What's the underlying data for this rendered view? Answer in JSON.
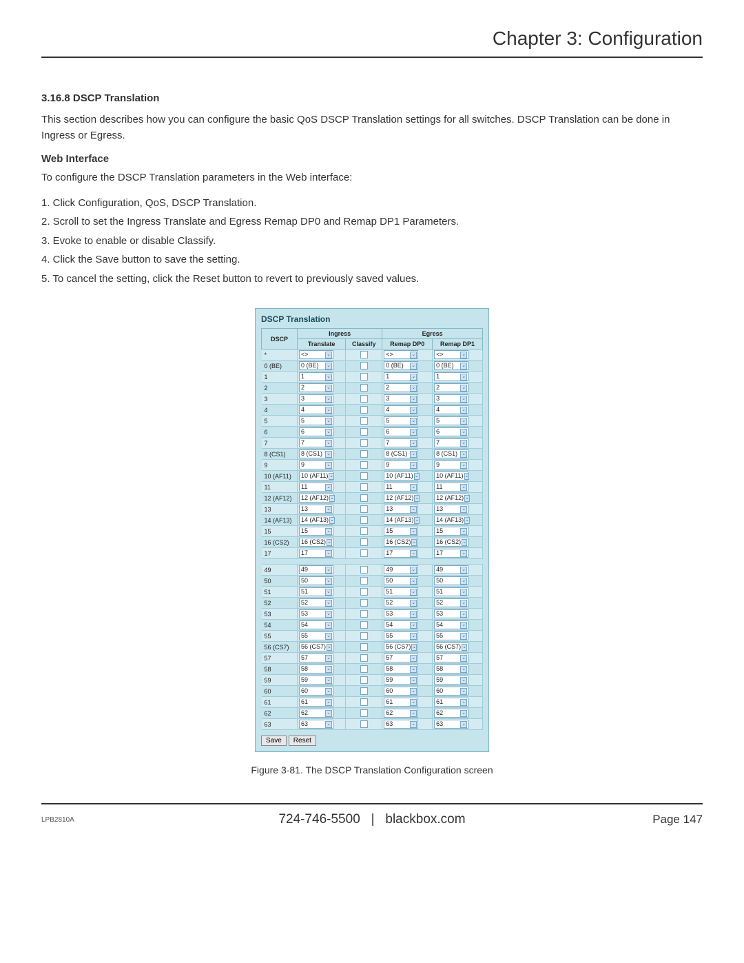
{
  "chapter": "Chapter 3: Configuration",
  "section": {
    "heading": "3.16.8 DSCP Translation",
    "intro": "This section describes how you can configure the basic QoS DSCP Translation settings for all switches. DSCP Translation can be done in Ingress or Egress.",
    "sub": "Web Interface",
    "lead": "To configure the DSCP Translation parameters in the Web interface:",
    "steps": [
      "1. Click Configuration, QoS, DSCP Translation.",
      "2. Scroll to set the Ingress Translate and Egress Remap DP0 and Remap DP1 Parameters.",
      "3. Evoke to enable or disable Classify.",
      "4. Click the Save button to save the setting.",
      "5. To cancel the setting, click the Reset button to revert to previously saved values."
    ]
  },
  "screenshot": {
    "title": "DSCP Translation",
    "headers": {
      "dscp": "DSCP",
      "ingress": "Ingress",
      "egress": "Egress",
      "translate": "Translate",
      "classify": "Classify",
      "remapdp0": "Remap DP0",
      "remapdp1": "Remap DP1"
    },
    "wildcard": {
      "dscp": "*",
      "val": "<>"
    },
    "rows_top": [
      {
        "dscp": "0  (BE)",
        "val": "0  (BE)"
      },
      {
        "dscp": "1",
        "val": "1"
      },
      {
        "dscp": "2",
        "val": "2"
      },
      {
        "dscp": "3",
        "val": "3"
      },
      {
        "dscp": "4",
        "val": "4"
      },
      {
        "dscp": "5",
        "val": "5"
      },
      {
        "dscp": "6",
        "val": "6"
      },
      {
        "dscp": "7",
        "val": "7"
      },
      {
        "dscp": "8  (CS1)",
        "val": "8  (CS1)"
      },
      {
        "dscp": "9",
        "val": "9"
      },
      {
        "dscp": "10 (AF11)",
        "val": "10 (AF11)"
      },
      {
        "dscp": "11",
        "val": "11"
      },
      {
        "dscp": "12 (AF12)",
        "val": "12 (AF12)"
      },
      {
        "dscp": "13",
        "val": "13"
      },
      {
        "dscp": "14 (AF13)",
        "val": "14 (AF13)"
      },
      {
        "dscp": "15",
        "val": "15"
      },
      {
        "dscp": "16 (CS2)",
        "val": "16 (CS2)"
      },
      {
        "dscp": "17",
        "val": "17"
      }
    ],
    "rows_bottom": [
      {
        "dscp": "49",
        "val": "49"
      },
      {
        "dscp": "50",
        "val": "50"
      },
      {
        "dscp": "51",
        "val": "51"
      },
      {
        "dscp": "52",
        "val": "52"
      },
      {
        "dscp": "53",
        "val": "53"
      },
      {
        "dscp": "54",
        "val": "54"
      },
      {
        "dscp": "55",
        "val": "55"
      },
      {
        "dscp": "56 (CS7)",
        "val": "56 (CS7)"
      },
      {
        "dscp": "57",
        "val": "57"
      },
      {
        "dscp": "58",
        "val": "58"
      },
      {
        "dscp": "59",
        "val": "59"
      },
      {
        "dscp": "60",
        "val": "60"
      },
      {
        "dscp": "61",
        "val": "61"
      },
      {
        "dscp": "62",
        "val": "62"
      },
      {
        "dscp": "63",
        "val": "63"
      }
    ],
    "buttons": {
      "save": "Save",
      "reset": "Reset"
    }
  },
  "caption": "Figure 3-81. The DSCP Translation Configuration screen",
  "footer": {
    "model": "LPB2810A",
    "phone": "724-746-5500",
    "sep": "|",
    "site": "blackbox.com",
    "page_label": "Page",
    "page_num": "147"
  }
}
